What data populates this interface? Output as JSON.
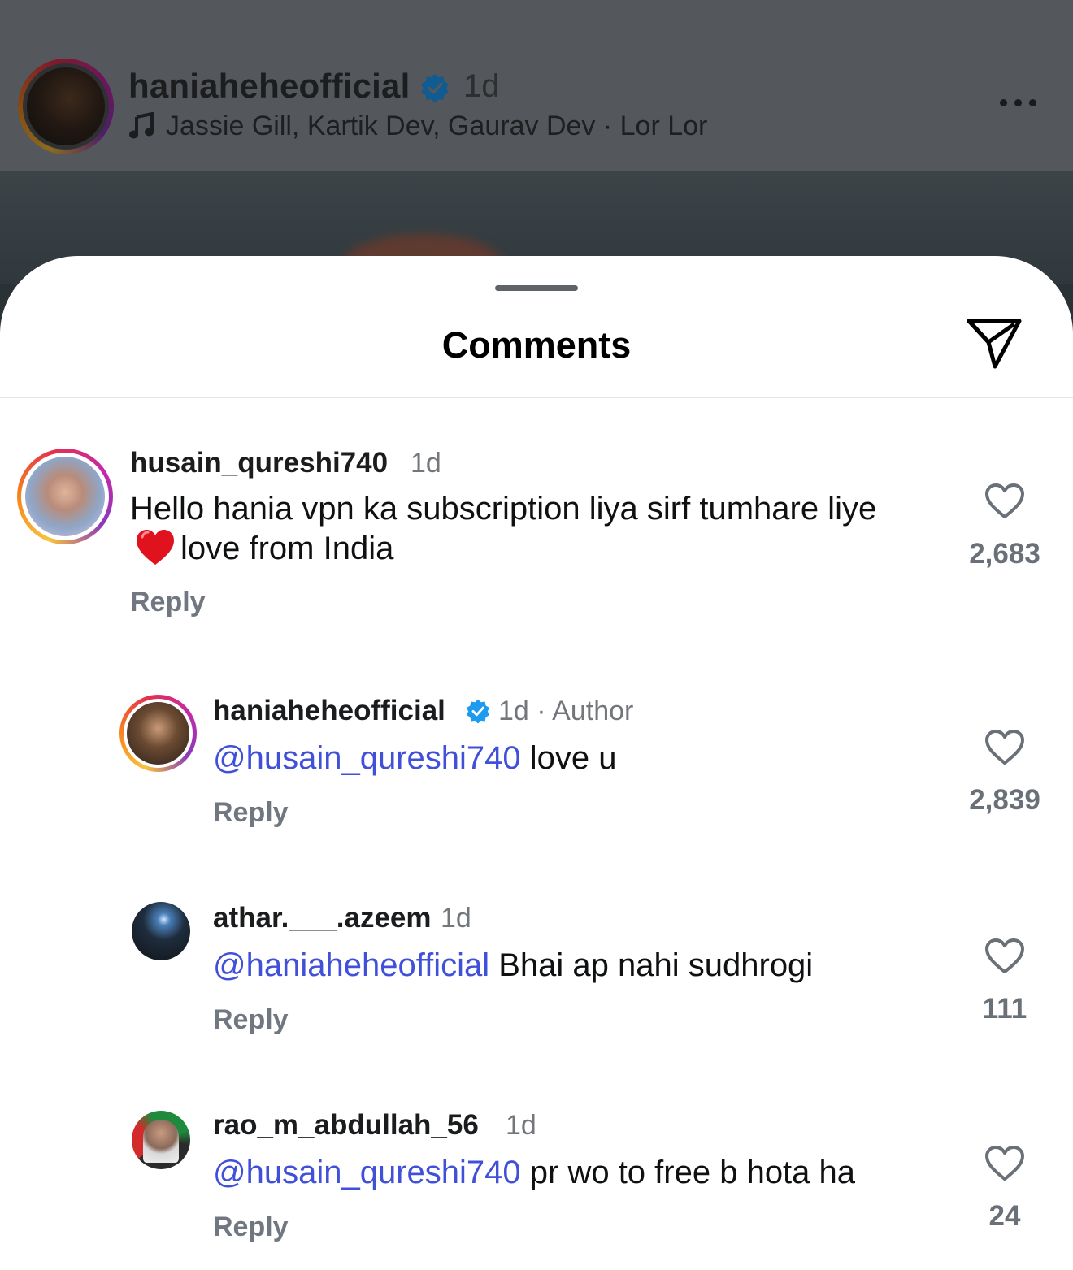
{
  "post": {
    "username": "haniaheheofficial",
    "time": "1d",
    "music": "Jassie Gill, Kartik Dev, Gaurav Dev · Lor Lor",
    "icons": {
      "verified": "verified-badge-icon",
      "music": "music-note-icon",
      "more": "more-options-icon"
    }
  },
  "sheet": {
    "title": "Comments",
    "share_icon": "send-icon"
  },
  "comments": [
    {
      "username": "husain_qureshi740",
      "time": "1d",
      "text_before": "Hello hania vpn ka subscription liya sirf tumhare liye",
      "emoji": "red-heart",
      "text_after": "love from India",
      "reply": "Reply",
      "likes": "2,683"
    },
    {
      "username": "haniaheheofficial",
      "time": "1d · Author",
      "mention": "@husain_qureshi740",
      "text": " love u",
      "reply": "Reply",
      "likes": "2,839"
    },
    {
      "username": "athar.___.azeem",
      "time": "1d",
      "mention": "@haniaheheofficial",
      "text": " Bhai ap nahi sudhrogi",
      "reply": "Reply",
      "likes": "111"
    },
    {
      "username": "rao_m_abdullah_56",
      "time": "1d",
      "mention": "@husain_qureshi740",
      "text": " pr wo to free b hota ha",
      "reply": "Reply",
      "likes": "24"
    }
  ],
  "colors": {
    "mention": "#4150d8",
    "verified": "#1d9bf0",
    "muted": "#73777c"
  }
}
